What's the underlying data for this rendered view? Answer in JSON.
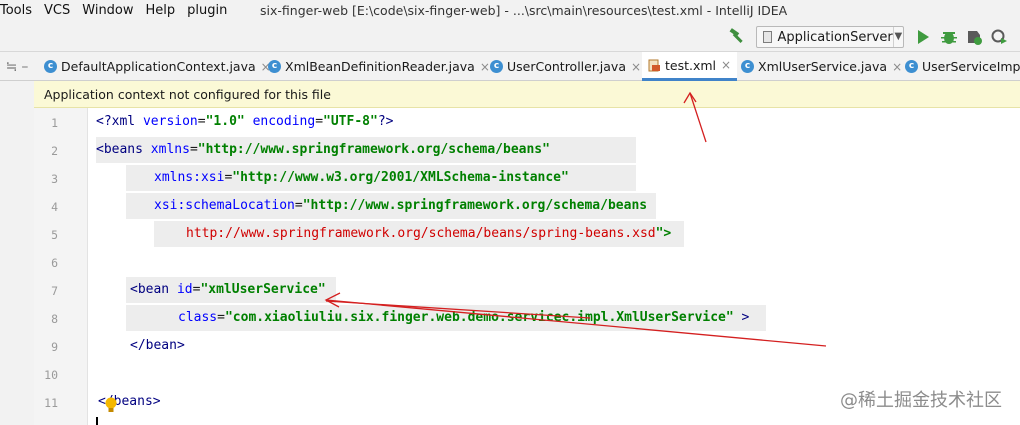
{
  "menu": {
    "items": [
      "Tools",
      "VCS",
      "Window",
      "Help",
      "plugin"
    ]
  },
  "window_title": "six-finger-web [E:\\code\\six-finger-web] - ...\\src\\main\\resources\\test.xml - IntelliJ IDEA",
  "toolbar": {
    "run_config_label": "ApplicationServer",
    "icons": [
      "hammer-icon",
      "run-icon",
      "debug-icon",
      "coverage-icon",
      "profile-icon"
    ]
  },
  "tabs": [
    {
      "label": "DefaultApplicationContext.java",
      "icon": "class-icon",
      "active": false
    },
    {
      "label": "XmlBeanDefinitionReader.java",
      "icon": "class-icon",
      "active": false
    },
    {
      "label": "UserController.java",
      "icon": "class-icon",
      "active": false
    },
    {
      "label": "test.xml",
      "icon": "xml-file-icon",
      "active": true
    },
    {
      "label": "XmlUserService.java",
      "icon": "class-icon",
      "active": false
    },
    {
      "label": "UserServiceImpl.",
      "icon": "class-icon",
      "active": false
    }
  ],
  "notification": "Application context not configured for this file",
  "line_numbers": [
    "1",
    "2",
    "3",
    "4",
    "5",
    "6",
    "7",
    "8",
    "9",
    "10",
    "11"
  ],
  "code": {
    "l1": {
      "open": "<?",
      "tag": "xml",
      "attr1": "version",
      "eq1": "=",
      "val1": "\"1.0\"",
      "attr2": "encoding",
      "eq2": "=",
      "val2": "\"UTF-8\"",
      "close": "?>"
    },
    "l2": {
      "tag": "<beans",
      "attr": "xmlns",
      "eq": "=",
      "val": "\"http://www.springframework.org/schema/beans\""
    },
    "l3": {
      "attr": "xmlns:xsi",
      "eq": "=",
      "val": "\"http://www.w3.org/2001/XMLSchema-instance\""
    },
    "l4": {
      "ns": "xsi",
      "attr": ":schemaLocation",
      "eq": "=",
      "val": "\"http://www.springframework.org/schema/beans"
    },
    "l5": {
      "url": "http://www.springframework.org/schema/beans/spring-beans.xsd",
      "tail": "\">"
    },
    "l7": {
      "tag": "<bean",
      "attr": "id",
      "eq": "=",
      "val": "\"xmlUserService\""
    },
    "l8": {
      "attr": "class",
      "eq": "=",
      "val": "\"com.xiaoliuliu.six.finger.web.demo.servicec.impl.XmlUserService\"",
      "close": " >"
    },
    "l9": {
      "tag": "</bean>"
    },
    "l11": {
      "open": "<",
      "tag": "/beans>"
    }
  },
  "watermark": "@稀土掘金技术社区",
  "colors": {
    "notification_bg": "#fbf9d6",
    "active_tab_underline": "#4083c9",
    "annotation_arrow": "#d42020"
  }
}
